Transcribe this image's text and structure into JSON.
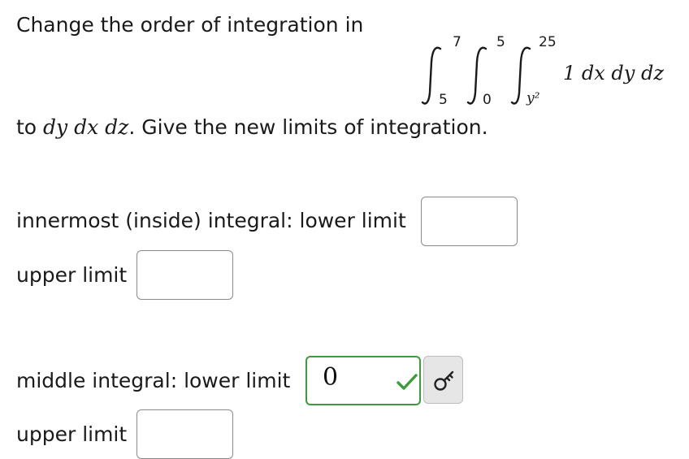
{
  "question": {
    "intro": "Change the order of integration in",
    "integral": {
      "outer_upper": "7",
      "outer_lower": "5",
      "middle_upper": "5",
      "middle_lower": "0",
      "inner_upper": "25",
      "inner_lower": "y²",
      "integrand": "1 dx dy dz"
    },
    "instruction_prefix": "to ",
    "instruction_order": "dy dx dz",
    "instruction_suffix": ". Give the new limits of integration."
  },
  "fields": {
    "innermost_lower_label": "innermost (inside) integral: lower limit",
    "innermost_lower_value": "",
    "innermost_upper_label": "upper limit",
    "innermost_upper_value": "",
    "middle_lower_label": "middle integral: lower limit",
    "middle_lower_value": "0",
    "middle_upper_label": "upper limit",
    "middle_upper_value": ""
  },
  "icons": {
    "check": "checkmark-icon",
    "key": "key-icon"
  },
  "colors": {
    "correct": "#3b9c3b",
    "border": "#8a8a8a",
    "button_bg": "#e6e6e6"
  }
}
